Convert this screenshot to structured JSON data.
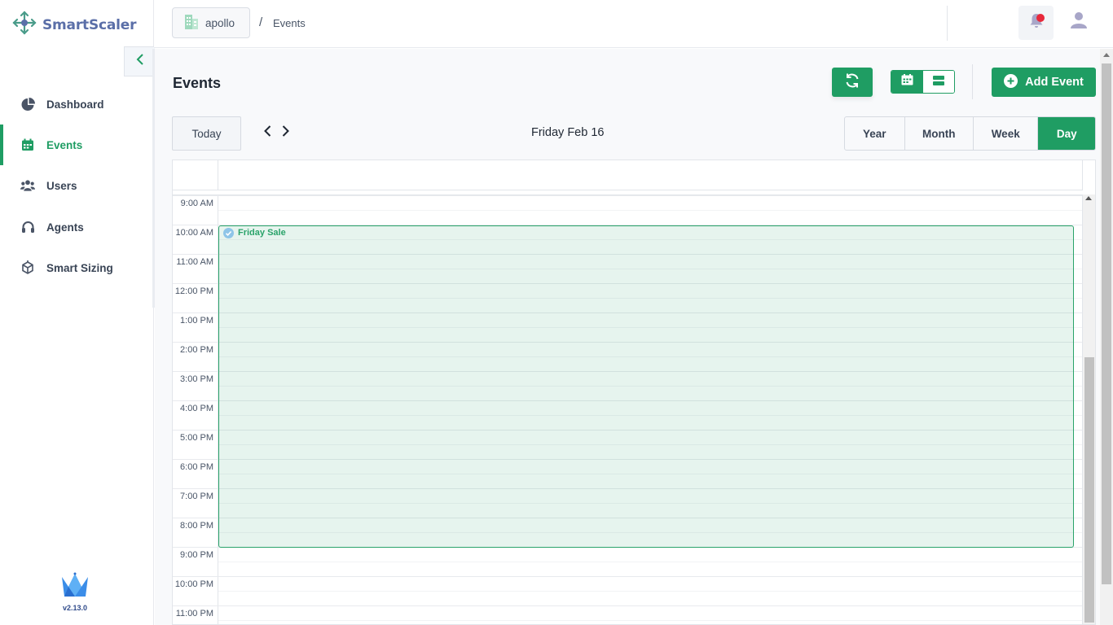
{
  "app": {
    "brand": "SmartScaler",
    "version": "v2.13.0"
  },
  "sidebar": {
    "items": [
      {
        "label": "Dashboard",
        "icon": "pie-chart-icon",
        "active": false
      },
      {
        "label": "Events",
        "icon": "calendar-icon",
        "active": true
      },
      {
        "label": "Users",
        "icon": "users-icon",
        "active": false
      },
      {
        "label": "Agents",
        "icon": "headset-icon",
        "active": false
      },
      {
        "label": "Smart Sizing",
        "icon": "cube-sizing-icon",
        "active": false
      }
    ]
  },
  "header": {
    "tenant": "apollo",
    "breadcrumb_sep": "/",
    "breadcrumb_current": "Events"
  },
  "page": {
    "title": "Events",
    "add_event_label": "Add Event",
    "today_label": "Today",
    "current_date": "Friday Feb 16",
    "ranges": [
      "Year",
      "Month",
      "Week",
      "Day"
    ],
    "active_range": "Day"
  },
  "calendar": {
    "time_labels": [
      "9:00 AM",
      "10:00 AM",
      "11:00 AM",
      "12:00 PM",
      "1:00 PM",
      "2:00 PM",
      "3:00 PM",
      "4:00 PM",
      "5:00 PM",
      "6:00 PM",
      "7:00 PM",
      "8:00 PM",
      "9:00 PM",
      "10:00 PM",
      "11:00 PM"
    ],
    "event": {
      "title": "Friday Sale",
      "start": "10:00 AM",
      "end": "9:00 PM"
    }
  },
  "colors": {
    "accent": "#1f9d63",
    "notification": "#e8283a",
    "brand_text": "#5b6fa8"
  }
}
